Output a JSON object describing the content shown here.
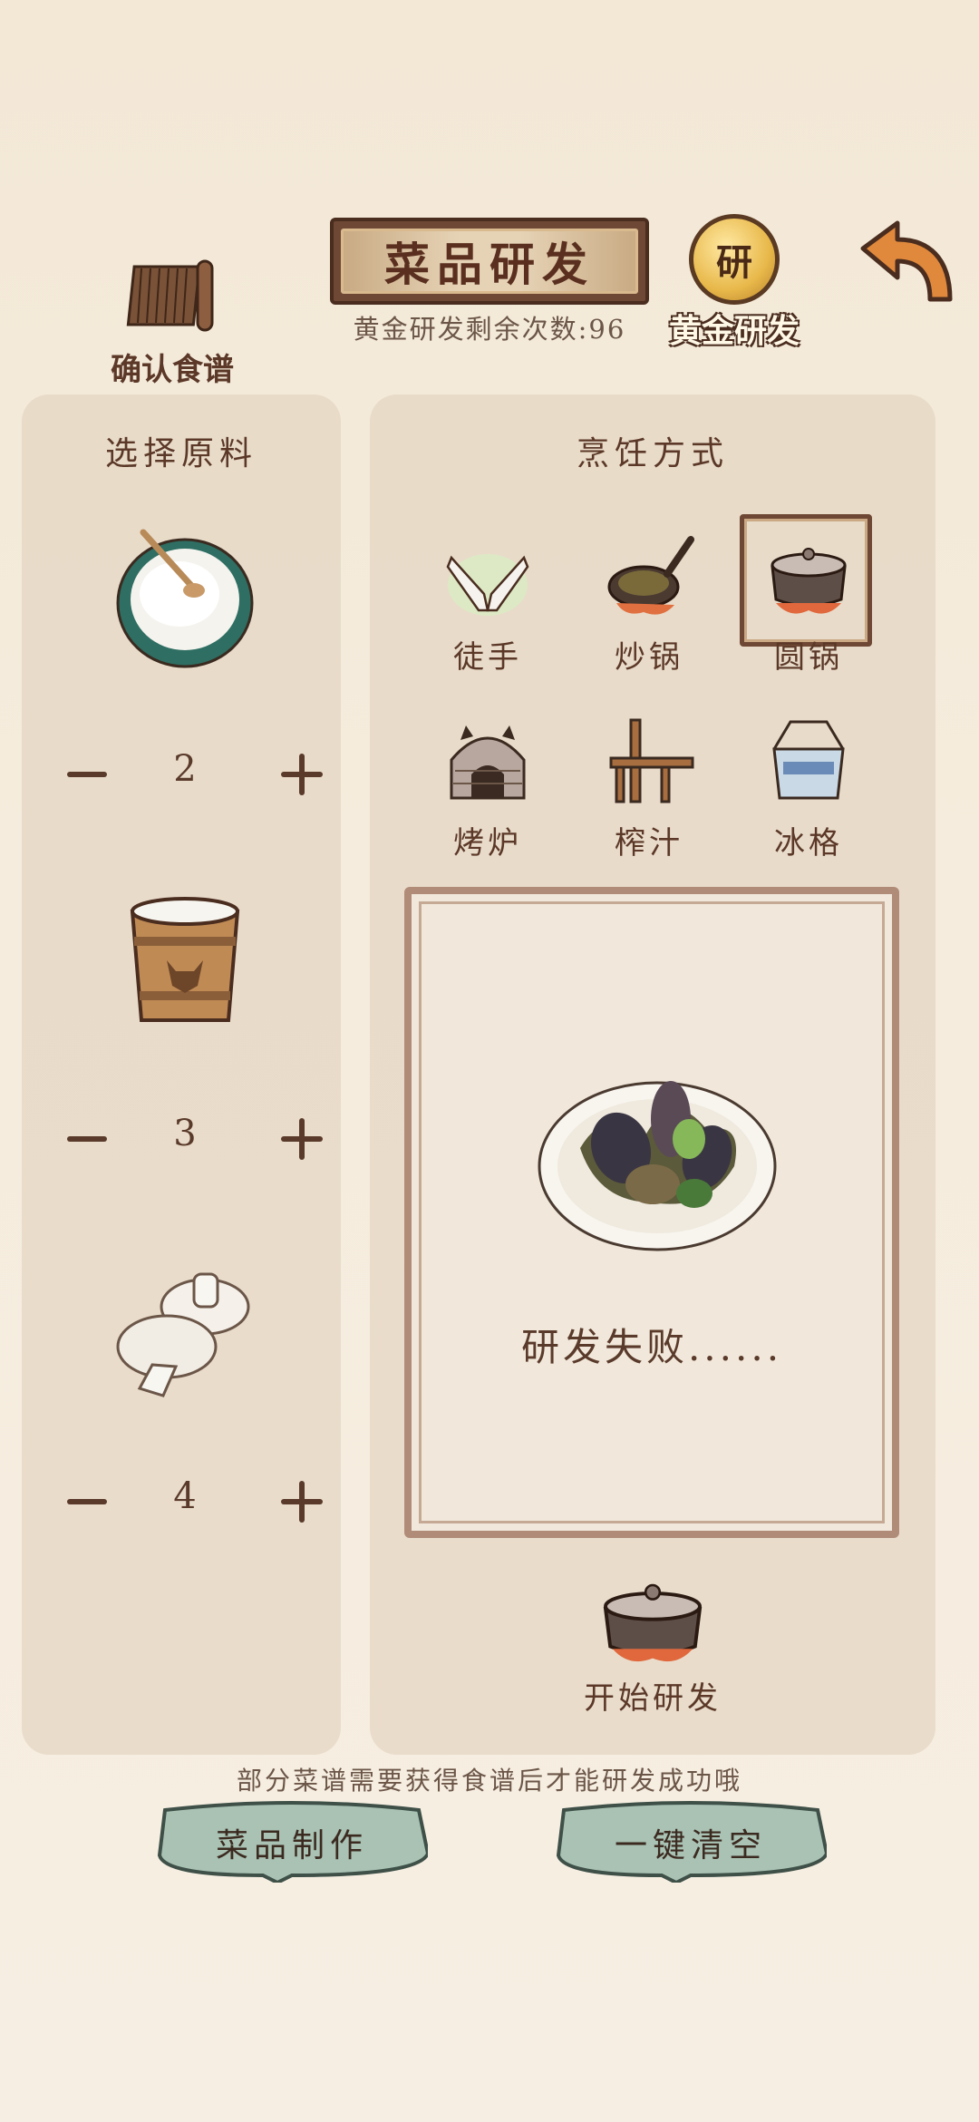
{
  "header": {
    "recipe_book_label": "确认食谱",
    "title": "菜品研发",
    "golden_remaining_text": "黄金研发剩余次数:96",
    "golden_coin_glyph": "研",
    "golden_label": "黄金研发",
    "back_icon": "back-arrow-icon"
  },
  "ingredients": {
    "title": "选择原料",
    "items": [
      {
        "icon": "rice-bowl-icon",
        "quantity": "2"
      },
      {
        "icon": "milk-bucket-icon",
        "quantity": "3"
      },
      {
        "icon": "mushroom-icon",
        "quantity": "4"
      }
    ]
  },
  "cooking": {
    "title": "烹饪方式",
    "methods": [
      {
        "label": "徒手",
        "icon": "hands-icon",
        "selected": false
      },
      {
        "label": "炒锅",
        "icon": "frying-pan-icon",
        "selected": false
      },
      {
        "label": "圆锅",
        "icon": "round-pot-icon",
        "selected": true
      },
      {
        "label": "烤炉",
        "icon": "oven-icon",
        "selected": false
      },
      {
        "label": "榨汁",
        "icon": "juicer-icon",
        "selected": false
      },
      {
        "label": "冰格",
        "icon": "ice-box-icon",
        "selected": false
      }
    ],
    "result_text": "研发失败......",
    "start_label": "开始研发"
  },
  "footer": {
    "hint": "部分菜谱需要获得食谱后才能研发成功哦",
    "make_dish_label": "菜品制作",
    "clear_all_label": "一键清空"
  },
  "colors": {
    "background": "#f4ebdc",
    "panel": "#ded0be",
    "title_plate": "#6e4834",
    "text_brown": "#5a3a2a",
    "button_green": "#a9c2b4",
    "gold": "#e8b84a"
  }
}
